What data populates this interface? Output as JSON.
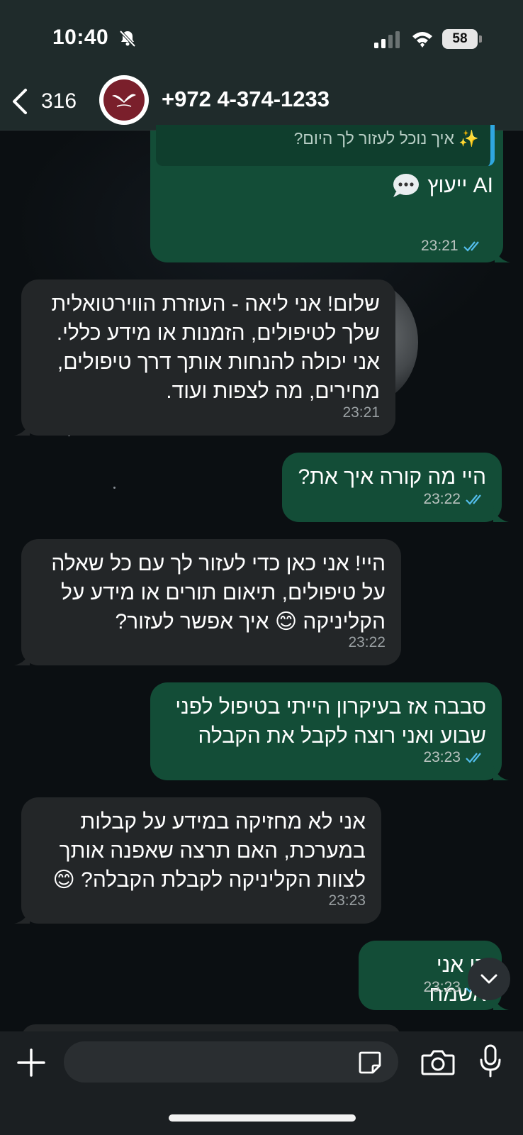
{
  "status_bar": {
    "time": "10:40",
    "battery": "58",
    "icons": [
      "bell-muted-icon",
      "signal-icon",
      "wifi-icon",
      "battery-icon"
    ]
  },
  "header": {
    "back_count": "316",
    "contact_name": "+972 4-374-1233",
    "avatar_icon": "clinic-logo-icon"
  },
  "messages": {
    "m0": {
      "quote": "✨ איך נוכל לעזור לך היום?",
      "ai_label": "ייעוץ AI",
      "time": "23:21",
      "direction": "out"
    },
    "m1": {
      "lines": [
        "שלום! אני ליאה - העוזרת הווירטואלית",
        "שלך לטיפולים, הזמנות או מידע כללי.",
        "אני יכולה להנחות אותך דרך טיפולים,",
        "מחירים, מה לצפות ועוד."
      ],
      "time": "23:21",
      "direction": "in"
    },
    "m2": {
      "lines": [
        "היי מה קורה איך את?"
      ],
      "time": "23:22",
      "direction": "out"
    },
    "m3": {
      "lines": [
        "היי! אני כאן כדי לעזור לך עם כל שאלה",
        "על טיפולים, תיאום תורים או מידע על",
        "הקליניקה 😊 איך אפשר לעזור?"
      ],
      "time": "23:22",
      "direction": "in"
    },
    "m4": {
      "lines": [
        "סבבה אז בעיקרון הייתי בטיפול לפני",
        "שבוע ואני רוצה לקבל את הקבלה"
      ],
      "time": "23:23",
      "direction": "out"
    },
    "m5": {
      "lines": [
        "אני לא מחזיקה במידע על קבלות",
        "במערכת, האם תרצה שאפנה אותך",
        "לצוות הקליניקה לקבלת הקבלה? 😊"
      ],
      "time": "23:23",
      "direction": "in"
    },
    "m6": {
      "lines": [
        "כן אני אשמח"
      ],
      "time": "23:23",
      "direction": "out"
    }
  },
  "composer": {
    "placeholder": "",
    "icons": [
      "plus-icon",
      "sticker-icon",
      "camera-icon",
      "microphone-icon",
      "chevron-down-icon"
    ]
  },
  "colors": {
    "outgoing_bubble": "#134d37",
    "incoming_bubble": "#232628",
    "read_ticks": "#53bdeb",
    "header_bg": "#1f2b2b"
  }
}
